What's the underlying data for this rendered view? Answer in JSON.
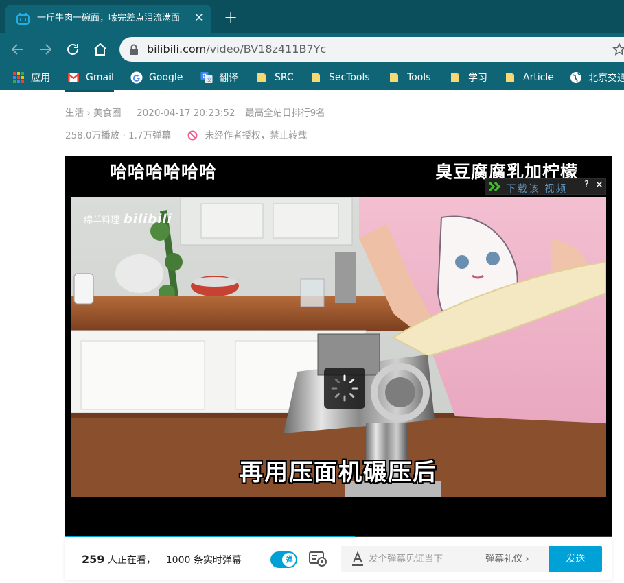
{
  "browser": {
    "tab_title": "一斤牛肉一碗面，嗦完差点泪流满面",
    "tab_close_glyph": "✕",
    "new_tab_glyph": "+",
    "url_host": "bilibili.com",
    "url_path": "/video/BV18z411B7Yc",
    "colors": {
      "tabstrip": "#0b4e5c",
      "toolbar": "#0f6475"
    }
  },
  "bookmarks": [
    {
      "label": "应用",
      "icon": "apps-grid-icon"
    },
    {
      "label": "Gmail",
      "icon": "gmail-icon"
    },
    {
      "label": "Google",
      "icon": "google-icon"
    },
    {
      "label": "翻译",
      "icon": "translate-icon"
    },
    {
      "label": "SRC",
      "icon": "folder-icon"
    },
    {
      "label": "SecTools",
      "icon": "folder-icon"
    },
    {
      "label": "Tools",
      "icon": "folder-icon"
    },
    {
      "label": "学习",
      "icon": "folder-icon"
    },
    {
      "label": "Article",
      "icon": "folder-icon"
    },
    {
      "label": "北京交通",
      "icon": "globe-icon"
    }
  ],
  "video_info": {
    "category": "生活",
    "breadcrumb_sep": "›",
    "subcategory": "美食圈",
    "datetime": "2020-04-17 20:23:52",
    "rank": "最高全站日排行9名",
    "plays": "258.0万播放",
    "dot": "·",
    "danmaku_count": "1.7万弹幕",
    "copyright": "未经作者授权，禁止转载"
  },
  "player": {
    "top_text_left": "哈哈哈哈哈哈",
    "top_text_right": "臭豆腐腐乳加柠檬",
    "download_label": "下载该 视频",
    "help_glyph": "?",
    "close_glyph": "✕",
    "watermark_cn": "绵羊料理",
    "watermark_logo": "bilibili",
    "subtitle": "再用压面机碾压后",
    "progress_percent": 53,
    "colors": {
      "accent": "#00a1d6"
    }
  },
  "danmaku": {
    "viewers_count": "259",
    "viewers_text": "人正在看，",
    "realtime_count": "1000",
    "realtime_text": "条实时弹幕",
    "toggle_label": "弹",
    "input_placeholder": "发个弹幕见证当下",
    "etiquette": "弹幕礼仪 ›",
    "send_label": "发送"
  }
}
